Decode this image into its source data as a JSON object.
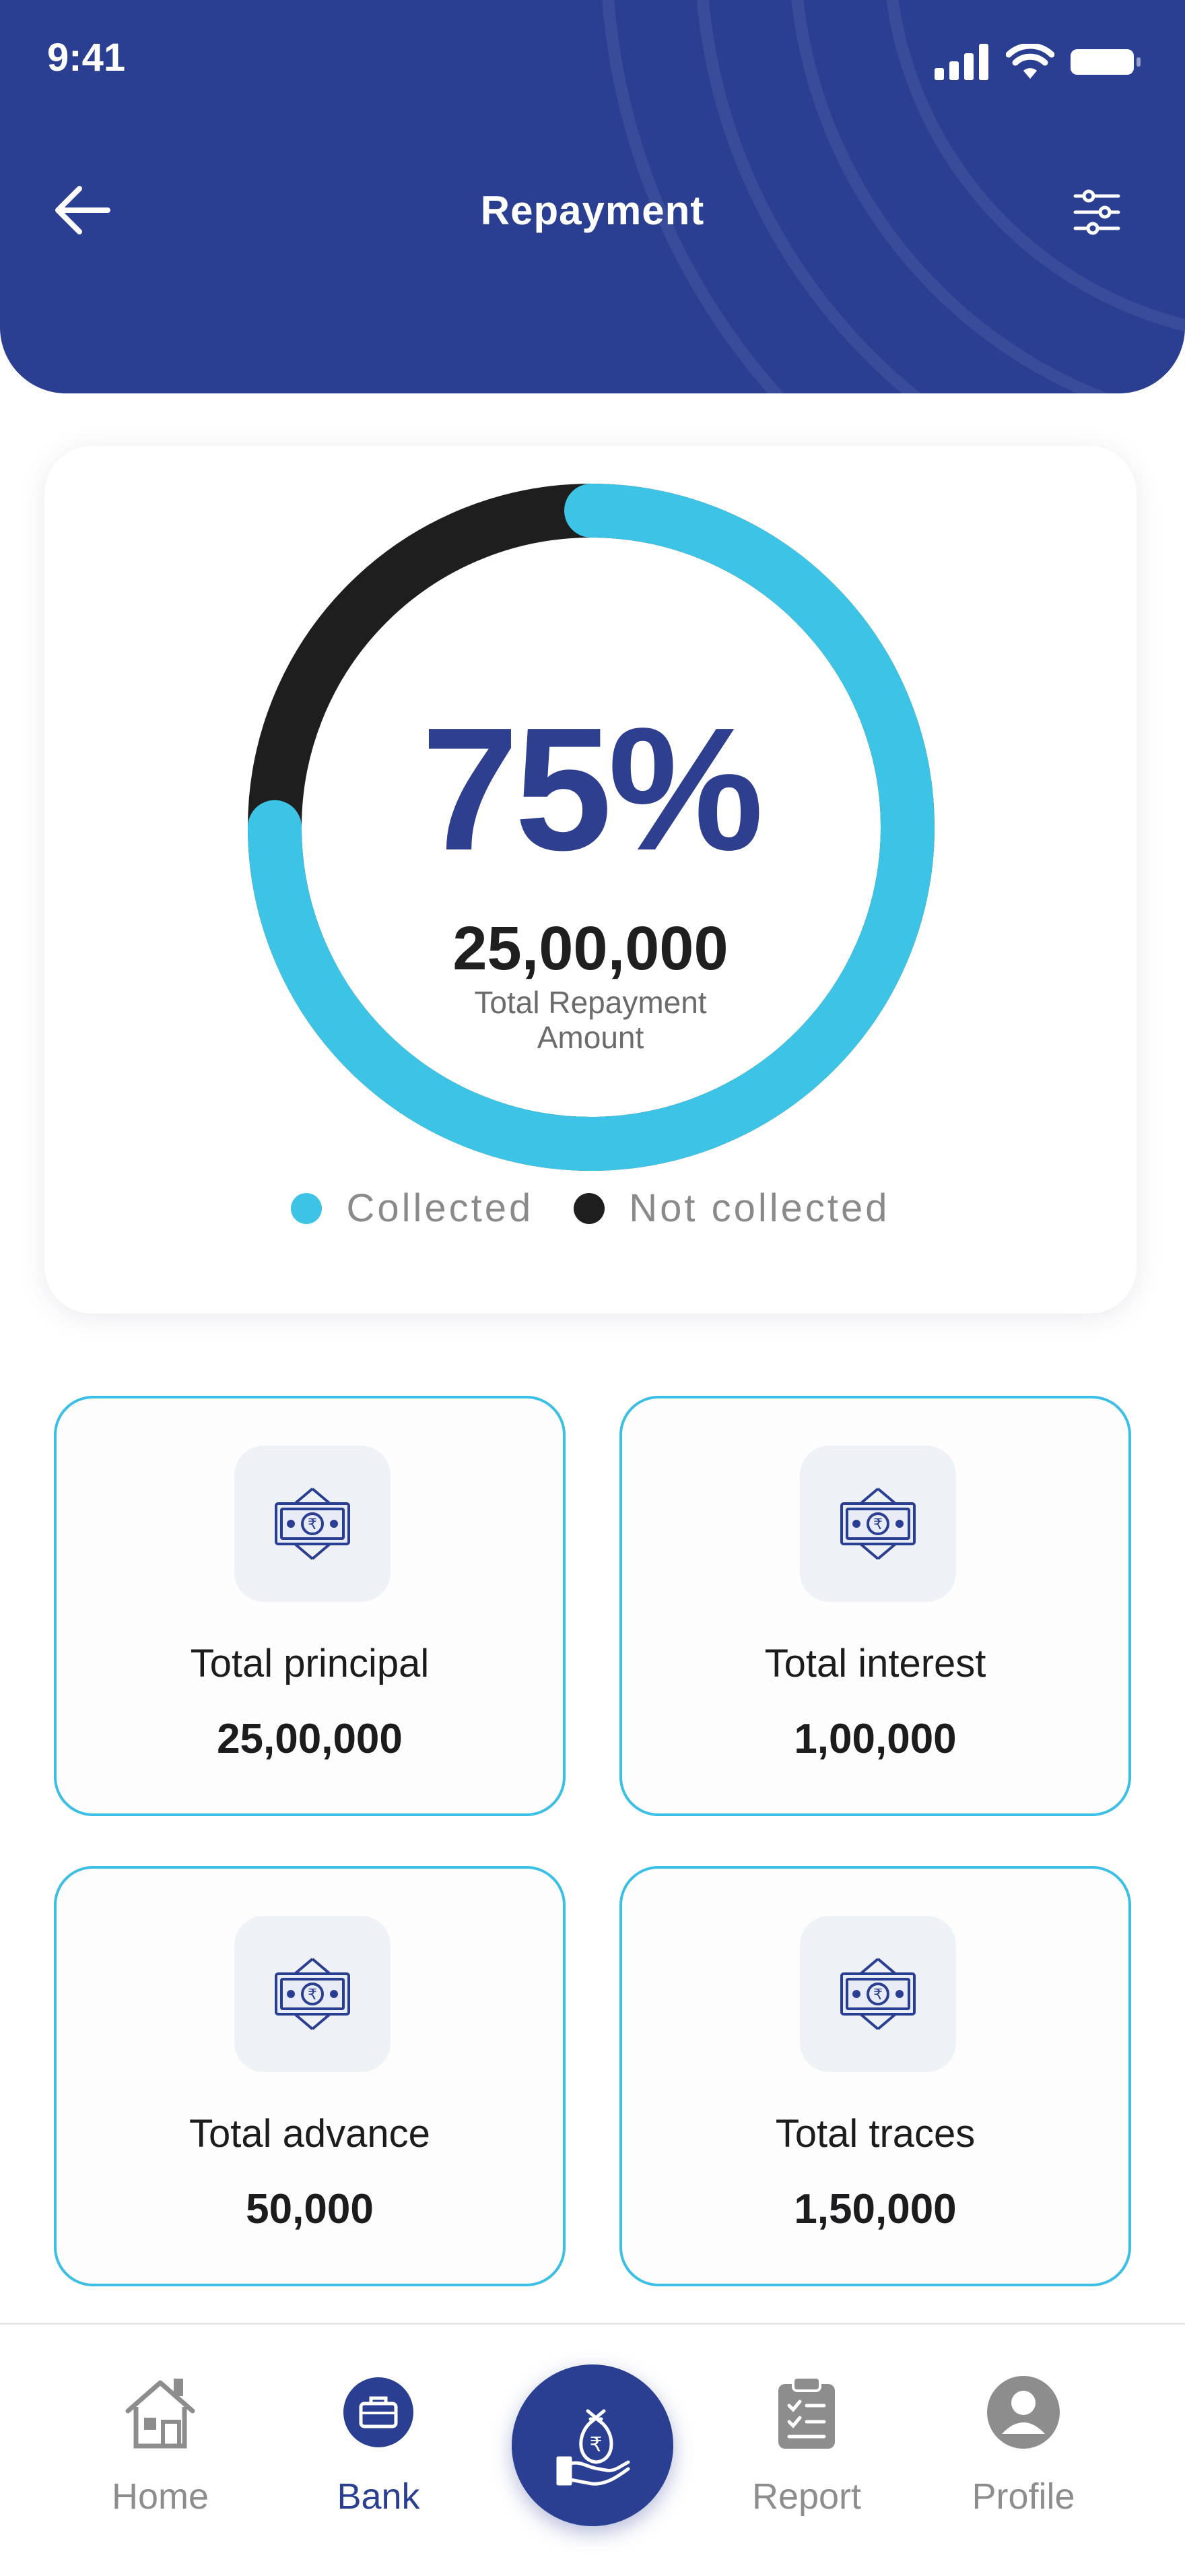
{
  "status_bar": {
    "time": "9:41"
  },
  "header": {
    "title": "Repayment"
  },
  "summary": {
    "percent_label": "75%",
    "collected_fraction": 0.75,
    "amount": "25,00,000",
    "caption": "Total Repayment Amount",
    "colors": {
      "collected": "#3cc3e5",
      "not_collected": "#1e1e1e",
      "percent_text": "#2f3f8f"
    },
    "legend": [
      {
        "label": "Collected",
        "color": "#3cc3e5"
      },
      {
        "label": "Not collected",
        "color": "#1e1e1e"
      }
    ]
  },
  "stats": [
    {
      "label": "Total principal",
      "value": "25,00,000",
      "icon": "banknote-icon"
    },
    {
      "label": "Total interest",
      "value": "1,00,000",
      "icon": "banknote-icon"
    },
    {
      "label": "Total advance",
      "value": "50,000",
      "icon": "banknote-icon"
    },
    {
      "label": "Total traces",
      "value": "1,50,000",
      "icon": "banknote-icon"
    }
  ],
  "nav": {
    "items": [
      {
        "label": "Home",
        "icon": "home-icon",
        "active": false
      },
      {
        "label": "Bank",
        "icon": "briefcase-icon",
        "active": true
      },
      {
        "label": "Report",
        "icon": "clipboard-icon",
        "active": false
      },
      {
        "label": "Profile",
        "icon": "user-icon",
        "active": false
      }
    ],
    "center_action_icon": "money-bag-hand-icon"
  },
  "theme": {
    "primary": "#2b3f92",
    "accent": "#3cbfe5"
  }
}
